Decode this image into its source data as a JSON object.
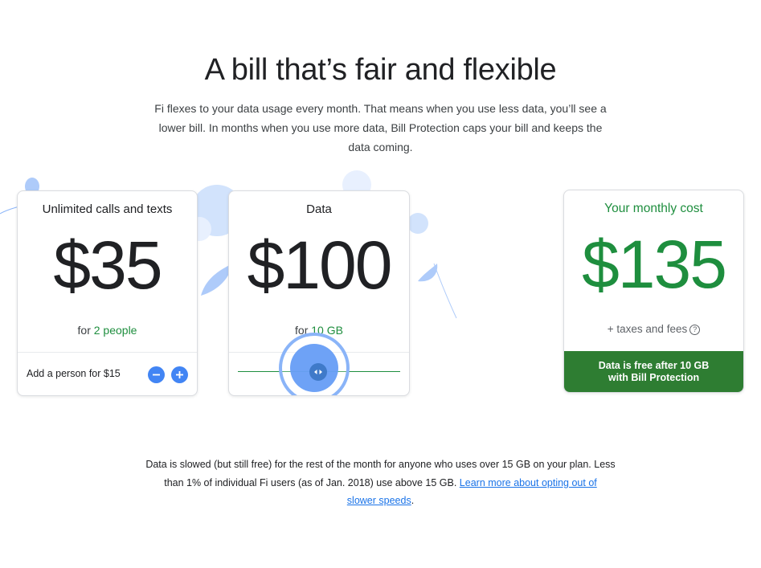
{
  "header": {
    "title": "A bill that’s fair and flexible",
    "subtitle": "Fi flexes to your data usage every month. That means when you use less data, you’ll see a lower bill. In months when you use more data, Bill Protection caps your bill and keeps the data coming."
  },
  "calls_card": {
    "title": "Unlimited calls and texts",
    "price": "$35",
    "for_prefix": "for ",
    "people": "2 people",
    "add_label": "Add a person for $15",
    "minus_icon": "minus-icon",
    "plus_icon": "plus-icon"
  },
  "data_card": {
    "title": "Data",
    "price": "$100",
    "for_prefix": "for ",
    "amount": "10 GB",
    "slider_value_gb": 10
  },
  "cost_card": {
    "title": "Your monthly cost",
    "price": "$135",
    "taxes": "+ taxes and fees",
    "help_icon": "help-circle-icon",
    "banner_line1": "Data is free after 10 GB",
    "banner_line2": "with Bill Protection"
  },
  "footnote": {
    "text": "Data is slowed (but still free) for the rest of the month for anyone who uses over 15 GB on your plan. Less than 1% of individual Fi users (as of Jan. 2018) use above 15 GB. ",
    "link_part1": "Learn more about opting out of",
    "link_part2": "slower speeds",
    "end": "."
  },
  "colors": {
    "accent_blue": "#4285f4",
    "accent_green": "#1e8e3e",
    "banner_green": "#2e7d32"
  }
}
